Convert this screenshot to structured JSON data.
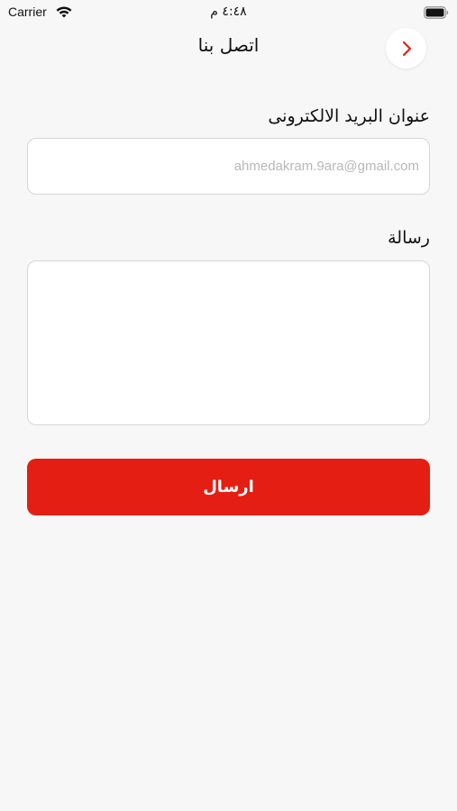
{
  "status_bar": {
    "carrier": "Carrier",
    "time": "٤:٤٨ م",
    "icons": [
      "wifi-icon",
      "battery-icon"
    ]
  },
  "header": {
    "title": "اتصل بنا",
    "back_icon": "chevron-right-icon"
  },
  "form": {
    "email": {
      "label": "عنوان البريد الالكترونى",
      "placeholder": "ahmedakram.9ara@gmail.com",
      "value": ""
    },
    "message": {
      "label": "رسالة",
      "value": ""
    },
    "submit_label": "ارسال"
  },
  "colors": {
    "accent": "#e41e12",
    "background": "#f7f7f7",
    "field_border": "#d6d6d6"
  }
}
